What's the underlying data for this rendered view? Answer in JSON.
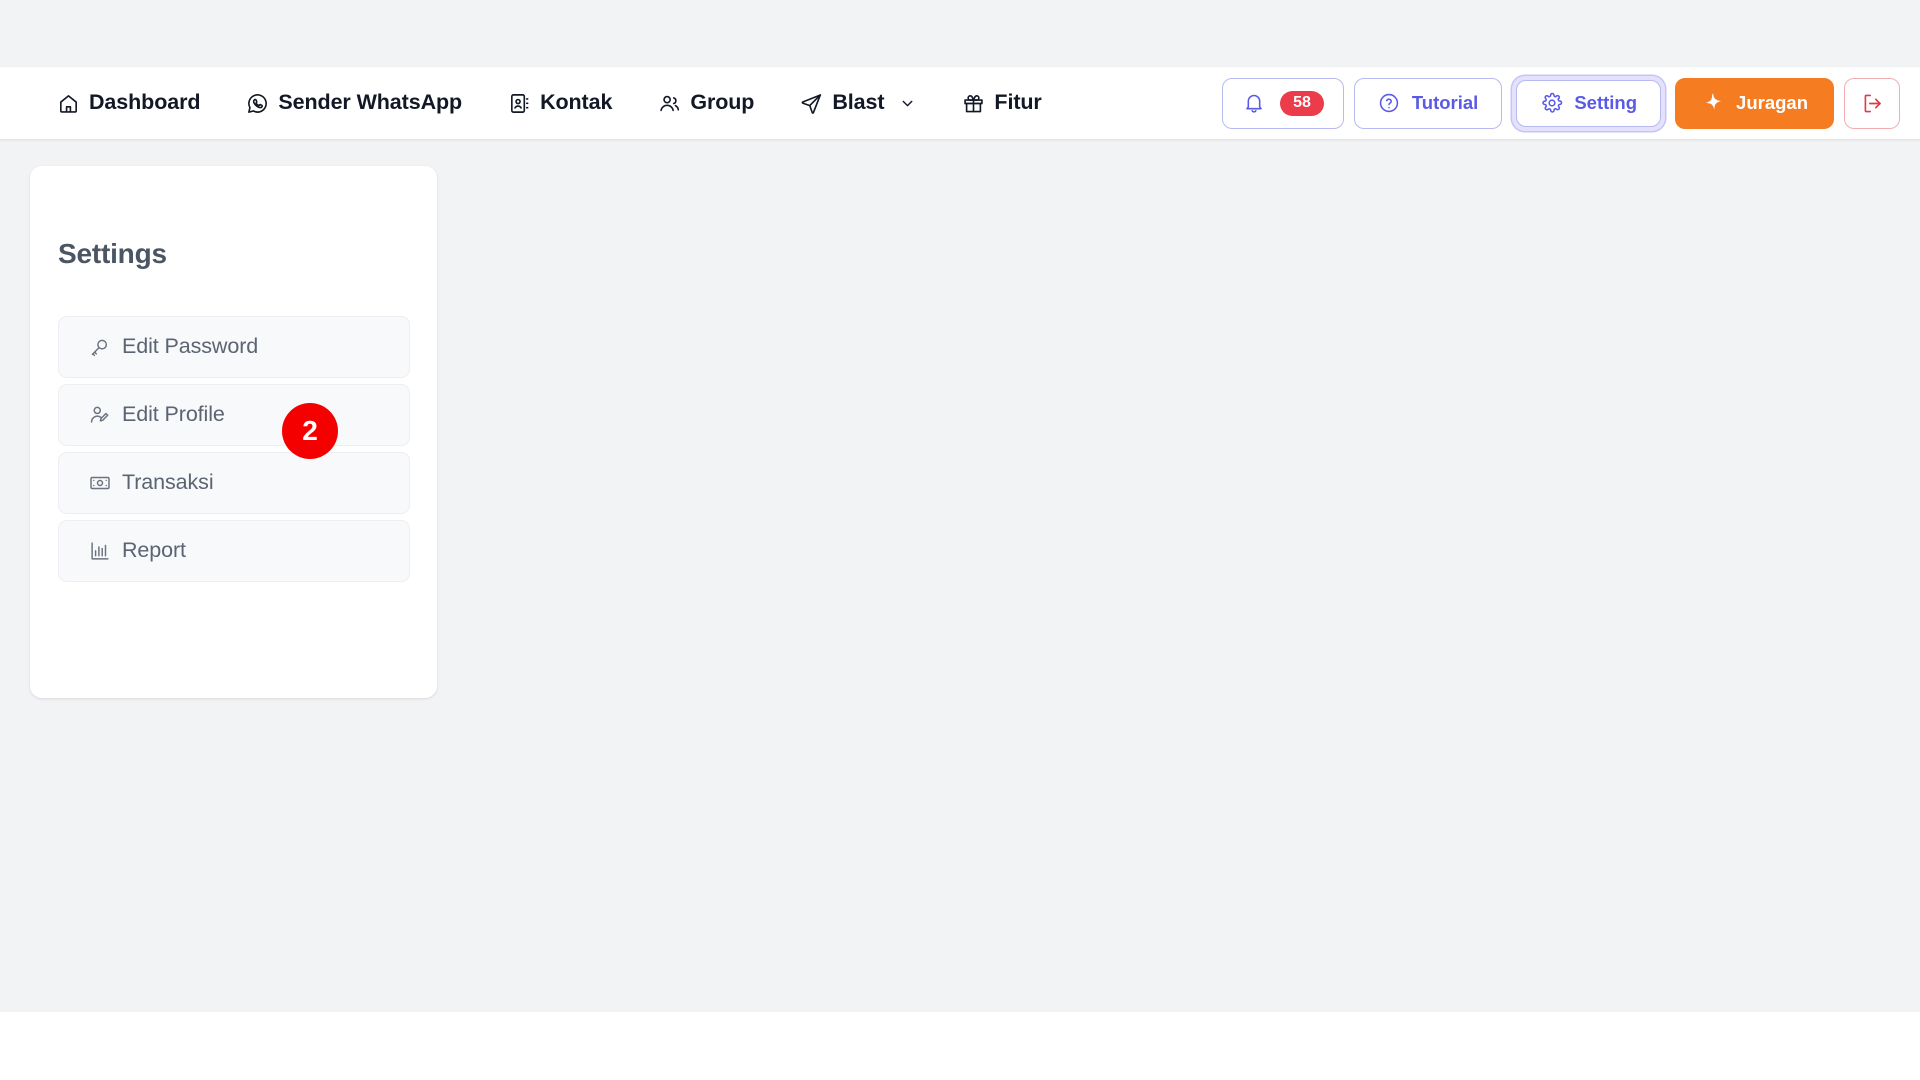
{
  "navbar": {
    "menu": [
      {
        "id": "dashboard",
        "label": "Dashboard",
        "icon": "home-icon",
        "has_caret": false
      },
      {
        "id": "sender-whatsapp",
        "label": "Sender WhatsApp",
        "icon": "whatsapp-icon",
        "has_caret": false
      },
      {
        "id": "kontak",
        "label": "Kontak",
        "icon": "contact-book-icon",
        "has_caret": false
      },
      {
        "id": "group",
        "label": "Group",
        "icon": "users-icon",
        "has_caret": false
      },
      {
        "id": "blast",
        "label": "Blast",
        "icon": "send-icon",
        "has_caret": true
      },
      {
        "id": "fitur",
        "label": "Fitur",
        "icon": "gift-icon",
        "has_caret": false
      }
    ],
    "actions": {
      "notification": {
        "icon": "bell-icon",
        "count": "58"
      },
      "tutorial": {
        "label": "Tutorial",
        "icon": "question-circle-icon"
      },
      "setting": {
        "label": "Setting",
        "icon": "gear-icon",
        "focused": true
      },
      "juragan": {
        "label": "Juragan",
        "icon": "sparkle-star-icon"
      },
      "logout": {
        "icon": "logout-icon"
      }
    }
  },
  "settings_panel": {
    "title": "Settings",
    "items": [
      {
        "id": "edit-password",
        "label": "Edit Password",
        "icon": "key-icon"
      },
      {
        "id": "edit-profile",
        "label": "Edit Profile",
        "icon": "user-edit-icon"
      },
      {
        "id": "transaksi",
        "label": "Transaksi",
        "icon": "banknote-icon"
      },
      {
        "id": "report",
        "label": "Report",
        "icon": "bar-chart-icon"
      }
    ]
  },
  "annotation": {
    "step_badge": {
      "label": "2",
      "color": "#f50000",
      "attached_to": "edit-profile"
    }
  },
  "theme": {
    "page_background": "#ffffff",
    "canvas_background": "#f2f3f5",
    "accent_indigo": "#5a5ae6",
    "accent_orange": "#f57c20",
    "accent_red": "#ec3b4b",
    "logout_red": "#e03a4b",
    "text_dark": "#121826",
    "text_muted": "#5b6472"
  }
}
